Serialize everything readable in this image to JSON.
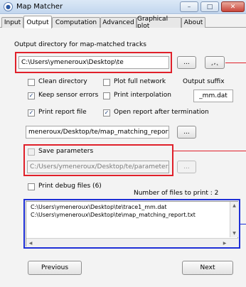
{
  "window": {
    "title": "Map Matcher",
    "app_icon": "globe-icon",
    "minimize_glyph": "–",
    "maximize_glyph": "□",
    "close_glyph": "✕"
  },
  "tabs": [
    {
      "label": "Input",
      "active": false
    },
    {
      "label": "Output",
      "active": true
    },
    {
      "label": "Computation",
      "active": false
    },
    {
      "label": "Advanced",
      "active": false
    },
    {
      "label": "Graphical plot",
      "active": false
    },
    {
      "label": "About",
      "active": false
    }
  ],
  "output": {
    "dir_label": "Output directory for map-matched tracks",
    "dir_value": "C:\\Users\\ymeneroux\\Desktop\\te",
    "browse_label": "...",
    "open_label": "¸,˛",
    "clean_label": "Clean directory",
    "clean_checked": false,
    "plot_label": "Plot full network",
    "plot_checked": false,
    "suffix_label": "Output suffix",
    "keep_label": "Keep sensor errors",
    "keep_checked": true,
    "interp_label": "Print interpolation",
    "interp_checked": false,
    "suffix_value": "_mm.dat",
    "report_label": "Print report file",
    "report_checked": true,
    "open_after_label": "Open report after termination",
    "open_after_checked": true,
    "report_path": "meneroux/Desktop/te/map_matching_report.txt",
    "report_browse_label": "...",
    "save_params_label": "Save parameters",
    "save_params_checked": false,
    "params_path": "C:/Users/ymeneroux/Desktop/te/parameters.txt",
    "params_browse_label": "...",
    "debug_label": "Print debug files (6)",
    "debug_checked": false,
    "files_count_label": "Number of files to print : 2",
    "files": [
      "C:\\Users\\ymeneroux\\Desktop\\te\\trace1_mm.dat",
      "C:\\Users\\ymeneroux\\Desktop\\te\\map_matching_report.txt"
    ],
    "previous_label": "Previous",
    "next_label": "Next"
  },
  "check_glyph": "✓"
}
